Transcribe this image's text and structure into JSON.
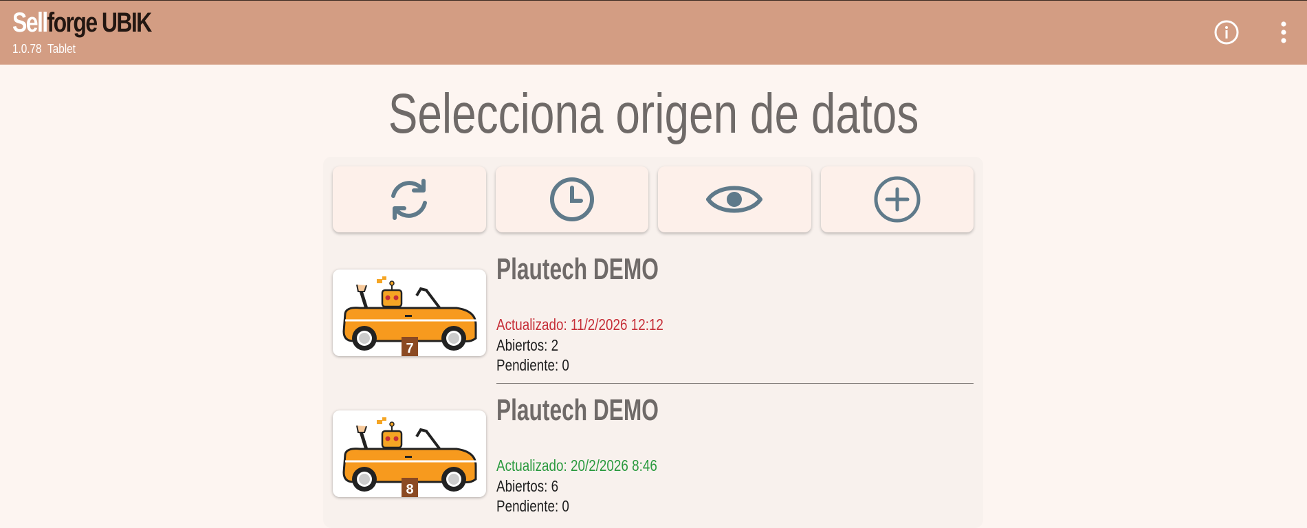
{
  "app": {
    "brand_part1": "Sell",
    "brand_part2": "forge UBIK",
    "version": "1.0.78",
    "device": "Tablet"
  },
  "page": {
    "title": "Selecciona origen de datos"
  },
  "actions": [
    {
      "icon": "refresh-icon"
    },
    {
      "icon": "clock-icon"
    },
    {
      "icon": "eye-icon"
    },
    {
      "icon": "add-circle-icon"
    }
  ],
  "sources": [
    {
      "name": "Plautech DEMO",
      "badge": "7",
      "updated": "Actualizado: 11/2/2026 12:12",
      "updated_color": "#c62f38",
      "open": "Abiertos: 2",
      "pending": "Pendiente: 0"
    },
    {
      "name": "Plautech DEMO",
      "badge": "8",
      "updated": "Actualizado: 20/2/2026 8:46",
      "updated_color": "#2b9a3f",
      "open": "Abiertos: 6",
      "pending": "Pendiente: 0"
    }
  ],
  "colors": {
    "appbar": "#d39d83",
    "icon": "#5f7a8a",
    "background": "#fdf5f1"
  }
}
